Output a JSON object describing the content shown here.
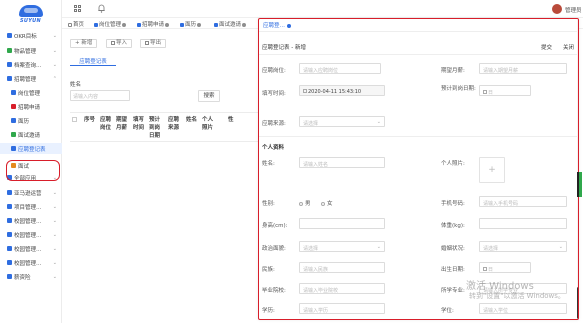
{
  "brand": {
    "logo_text": "SUYUN"
  },
  "colors": {
    "accent": "#2f6de0",
    "highlight": "#d81e2a",
    "active_bg": "#e9f1ff"
  },
  "topbar": {
    "user_name": "管理员"
  },
  "tabs": [
    {
      "label": "首页",
      "icon": "home-icon"
    },
    {
      "label": "岗位管理",
      "icon": "post-icon"
    },
    {
      "label": "招聘申请",
      "icon": "apply-icon"
    },
    {
      "label": "面历",
      "icon": "calendar-icon"
    },
    {
      "label": "面试邀请",
      "icon": "invite-icon"
    },
    {
      "label": "应聘登…",
      "icon": "form-icon"
    }
  ],
  "sidebar": {
    "items": [
      {
        "label": "OKR目标",
        "icon": "target-icon",
        "color": "#2f6de0"
      },
      {
        "label": "物品管理",
        "icon": "box-icon",
        "color": "#30a84c"
      },
      {
        "label": "档案查询…",
        "icon": "folder-icon",
        "color": "#2f6de0"
      },
      {
        "label": "招聘管理",
        "icon": "recruit-icon",
        "color": "#2f6de0"
      },
      {
        "label": "岗位管理",
        "icon": "post-icon",
        "color": "#2f6de0"
      },
      {
        "label": "招聘申请",
        "icon": "apply-icon",
        "color": "#d81e2a"
      },
      {
        "label": "面历",
        "icon": "calendar-icon",
        "color": "#2f6de0"
      },
      {
        "label": "面试邀请",
        "icon": "invite-icon",
        "color": "#30a84c"
      },
      {
        "label": "应聘登记表",
        "icon": "form-icon",
        "color": "#2f6de0"
      },
      {
        "label": "面试",
        "icon": "interview-icon",
        "color": "#e58a1e"
      },
      {
        "label": "全部应用",
        "icon": "apps-icon",
        "color": "#2f6de0"
      },
      {
        "label": "亚马逊运营",
        "icon": "amazon-icon",
        "color": "#2f6de0"
      },
      {
        "label": "项目管理…",
        "icon": "project-icon",
        "color": "#2f6de0"
      },
      {
        "label": "校园管理…",
        "icon": "campus-icon",
        "color": "#2f6de0"
      },
      {
        "label": "校园管理…",
        "icon": "campus-icon",
        "color": "#2f6de0"
      },
      {
        "label": "校园管理…",
        "icon": "campus-icon",
        "color": "#2f6de0"
      },
      {
        "label": "校园管理…",
        "icon": "campus-icon",
        "color": "#2f6de0"
      },
      {
        "label": "薪资险",
        "icon": "salary-icon",
        "color": "#2f6de0"
      }
    ]
  },
  "list_page": {
    "buttons": {
      "add": "+ 新增",
      "import": "导入",
      "export": "导出"
    },
    "sub_tab": "应聘登记表",
    "search_label": "姓名",
    "search_placeholder": "请输入内容",
    "search_button": "搜索",
    "columns": [
      "序号",
      "应聘岗位",
      "期望月薪",
      "填写时间",
      "预计到岗日期",
      "应聘来源",
      "姓名",
      "个人照片",
      "性"
    ]
  },
  "modal": {
    "tab_label": "应聘登…",
    "title": "应聘登记表 - 新增",
    "submit": "提交",
    "close": "关闭",
    "fields": {
      "post": {
        "label": "应聘岗位:",
        "placeholder": "请输入应聘岗位"
      },
      "salary": {
        "label": "期望月薪:",
        "placeholder": "请输入期望月薪"
      },
      "fill_time": {
        "label": "填写时间:",
        "value": "2020-04-11 15:43:10"
      },
      "arrive_date": {
        "label": "预计到岗日期:",
        "placeholder": "日"
      },
      "source": {
        "label": "应聘来源:",
        "placeholder": "请选择"
      }
    },
    "section_personal": "个人资料",
    "personal": {
      "name": {
        "label": "姓名:",
        "placeholder": "请输入姓名"
      },
      "photo": {
        "label": "个人照片:",
        "plus": "+"
      },
      "gender": {
        "label": "性别:",
        "options": [
          "男",
          "女"
        ]
      },
      "phone": {
        "label": "手机号码:",
        "placeholder": "请输入手机号码"
      },
      "height": {
        "label": "身高(cm):"
      },
      "weight": {
        "label": "体重(kg):"
      },
      "politics": {
        "label": "政治面貌:",
        "placeholder": "请选择"
      },
      "marriage": {
        "label": "婚姻状况:",
        "placeholder": "请选择"
      },
      "nation": {
        "label": "民族:",
        "placeholder": "请输入民族"
      },
      "birth": {
        "label": "出生日期:",
        "placeholder": "日"
      },
      "school": {
        "label": "毕业院校:",
        "placeholder": "请输入毕业院校"
      },
      "major": {
        "label": "所学专业:",
        "placeholder": "请输入所学专业"
      },
      "education": {
        "label": "学历:",
        "placeholder": "请输入学历"
      },
      "degree": {
        "label": "学位:",
        "placeholder": "请输入学位"
      }
    }
  },
  "watermark": {
    "line1": "激活 Windows",
    "line2": "转到\"设置\"以激活 Windows。"
  }
}
